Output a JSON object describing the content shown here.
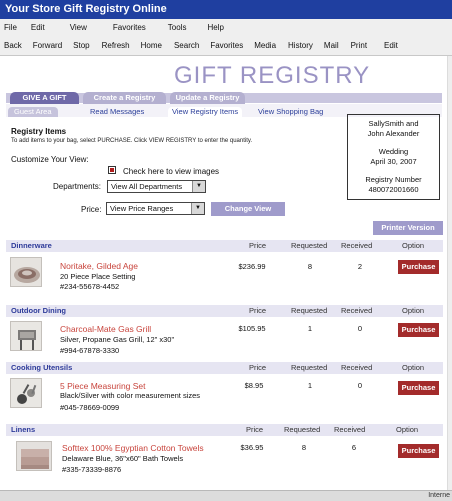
{
  "window": {
    "title": "Your Store Gift Registry Online"
  },
  "menu": [
    "File",
    "Edit",
    "View",
    "Favorites",
    "Tools",
    "Help"
  ],
  "toolbar": [
    "Back",
    "Forward",
    "Stop",
    "Refresh",
    "Home",
    "Search",
    "Favorites",
    "Media",
    "History",
    "Mail",
    "Print",
    "Edit"
  ],
  "header": {
    "title": "GIFT REGISTRY"
  },
  "tabs": [
    "GIVE A GIFT",
    "Create a Registry",
    "Update a Registry"
  ],
  "subtabs": [
    "Guest Area",
    "Read Messages",
    "View Registry Items",
    "View Shopping Bag"
  ],
  "registry": {
    "heading": "Registry Items",
    "help": "To add items to your bag, select PURCHASE.  Click VIEW REGISTRY to enter the quantity.",
    "customize": "Customize Your View:",
    "view_images": "Check here to view images",
    "departments_label": "Departments:",
    "departments_value": "View All Departments",
    "price_label": "Price:",
    "price_value": "View Price Ranges",
    "change_view": "Change View",
    "printer_version": "Printer Version"
  },
  "info": {
    "names_line1": "SallySmith and",
    "names_line2": "John Alexander",
    "event": "Wedding",
    "date": "April 30, 2007",
    "reg_number_label": "Registry Number",
    "reg_number": "480072001660"
  },
  "columns": {
    "price": "Price",
    "requested": "Requested",
    "received": "Received",
    "option": "Option"
  },
  "sections": [
    {
      "name": "Dinnerware",
      "item": {
        "title": "Noritake, Gilded Age",
        "desc": "20 Piece Place Setting",
        "number": "#234-55678-4452",
        "price": "$236.99",
        "requested": "8",
        "received": "2",
        "button": "Purchase"
      }
    },
    {
      "name": "Outdoor Dining",
      "item": {
        "title": "Charcoal-Mate Gas Grill",
        "desc": "Silver, Propane Gas Grill, 12\" x30\"",
        "number": "#994-67878-3330",
        "price": "$105.95",
        "requested": "1",
        "received": "0",
        "button": "Purchase"
      }
    },
    {
      "name": "Cooking Utensils",
      "item": {
        "title": "5 Piece Measuring Set",
        "desc": "Black/Silver with color measurement sizes",
        "number": "#045-78669-0099",
        "price": "$8.95",
        "requested": "1",
        "received": "0",
        "button": "Purchase"
      }
    },
    {
      "name": "Linens",
      "item": {
        "title": "Softtex 100% Egyptian Cotton Towels",
        "desc": "Delaware Blue, 36\"x60\" Bath Towels",
        "number": "#335-73339-8876",
        "price": "$36.95",
        "requested": "8",
        "received": "6",
        "button": "Purchase"
      }
    }
  ],
  "status": {
    "zone": "Interne"
  }
}
